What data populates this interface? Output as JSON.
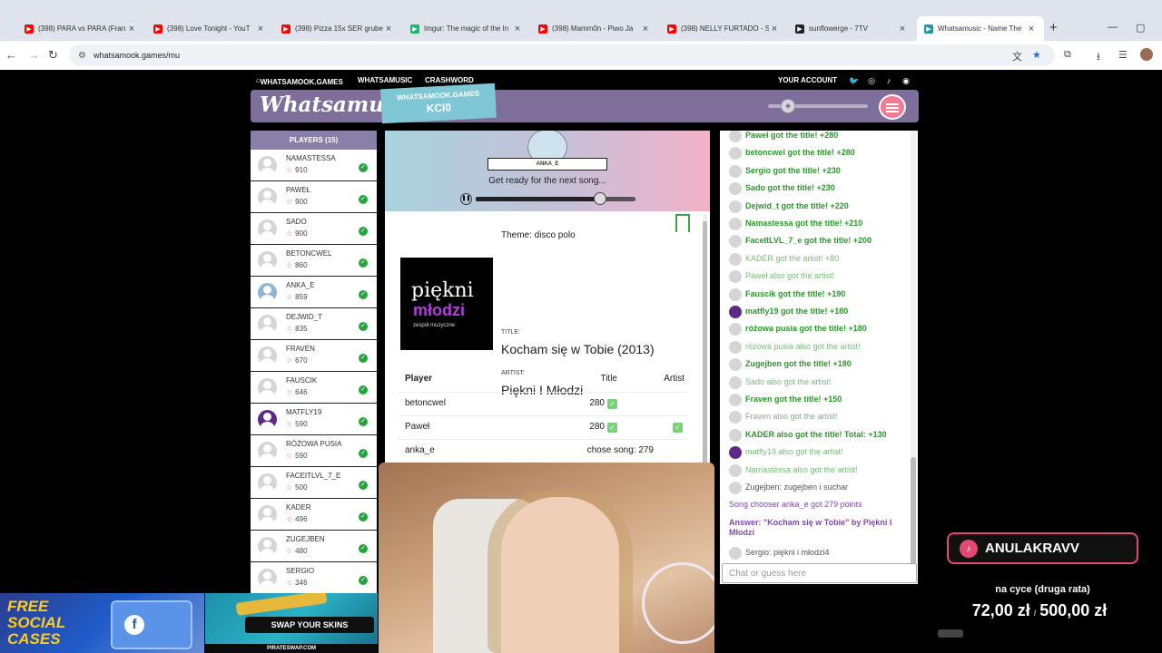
{
  "browser": {
    "tabs": [
      {
        "title": "(398) PARA vs PARA (Fran",
        "favicon": "youtube-icon",
        "color": "#ff0000"
      },
      {
        "title": "(398) Love Tonight - YouT",
        "favicon": "youtube-icon",
        "color": "#ff0000"
      },
      {
        "title": "(398) Pizza 15x SER grube",
        "favicon": "youtube-icon",
        "color": "#ff0000"
      },
      {
        "title": "Imgur: The magic of the In",
        "favicon": "imgur-icon",
        "color": "#1bb76e"
      },
      {
        "title": "(398) Mamm0n - Piwo Ja",
        "favicon": "youtube-icon",
        "color": "#ff0000"
      },
      {
        "title": "(398) NELLY FURTADO - S",
        "favicon": "youtube-icon",
        "color": "#ff0000"
      },
      {
        "title": "sunflowerge - 7TV",
        "favicon": "7tv-icon",
        "color": "#222222"
      },
      {
        "title": "Whatsamusic - Name The",
        "favicon": "whatsamusic-icon",
        "color": "#1a9aa8"
      }
    ],
    "url": "whatsamook.games/mu"
  },
  "nav": {
    "home": "WHATSAMOOK.GAMES",
    "whatsamusic": "WHATSAMUSIC",
    "crashword": "CRASHWORD",
    "account": "YOUR ACCOUNT"
  },
  "header": {
    "logo": "Whatsamusic",
    "room_site": "WHATSAMOOK.GAMES",
    "room_code": "KCI0",
    "volume": 0.15
  },
  "players": {
    "title": "PLAYERS (15)",
    "list": [
      {
        "name": "NAMASTESSA",
        "score": "910",
        "avatar": "default"
      },
      {
        "name": "PAWEŁ",
        "score": "900",
        "avatar": "default"
      },
      {
        "name": "SADO",
        "score": "900",
        "avatar": "default"
      },
      {
        "name": "BETONCWEL",
        "score": "860",
        "avatar": "default"
      },
      {
        "name": "ANKA_E",
        "score": "859",
        "avatar": "photo"
      },
      {
        "name": "DEJWID_T",
        "score": "835",
        "avatar": "default"
      },
      {
        "name": "FRAVEN",
        "score": "670",
        "avatar": "default"
      },
      {
        "name": "FAUSCIK",
        "score": "646",
        "avatar": "default"
      },
      {
        "name": "MATFLY19",
        "score": "590",
        "avatar": "purple"
      },
      {
        "name": "RÓŻOWA PUSIA",
        "score": "590",
        "avatar": "default"
      },
      {
        "name": "FACEITLVL_7_E",
        "score": "500",
        "avatar": "default"
      },
      {
        "name": "KADER",
        "score": "496",
        "avatar": "default"
      },
      {
        "name": "ZUGEJBEN",
        "score": "480",
        "avatar": "default"
      },
      {
        "name": "SERGIO",
        "score": "346",
        "avatar": "default"
      }
    ]
  },
  "round": {
    "chooser": "ANKA_E",
    "status": "Get ready for the next song...",
    "progress": 0.78,
    "theme": "Theme: disco polo",
    "cover_line1": "piękni",
    "cover_line2": "młodzi",
    "cover_line3": "zespół muzyczne",
    "title_label": "TITLE:",
    "title": "Kocham się w Tobie (2013)",
    "artist_label": "ARTIST:",
    "artist": "Piękni I Młodzi"
  },
  "results": {
    "headers": {
      "player": "Player",
      "title": "Title",
      "artist": "Artist"
    },
    "rows": [
      {
        "player": "betoncwel",
        "title": "280",
        "title_ok": true,
        "artist_ok": false,
        "note": ""
      },
      {
        "player": "Paweł",
        "title": "280",
        "title_ok": true,
        "artist_ok": true,
        "note": ""
      },
      {
        "player": "anka_e",
        "title": "",
        "title_ok": false,
        "artist_ok": false,
        "note": "chose song: 279"
      }
    ]
  },
  "chat": {
    "messages": [
      {
        "type": "g",
        "avatar": "default",
        "text": "Paweł got the title! +280"
      },
      {
        "type": "g",
        "avatar": "default",
        "text": "betoncwel got the title! +280"
      },
      {
        "type": "g",
        "avatar": "default",
        "text": "Sergio got the title! +230"
      },
      {
        "type": "g",
        "avatar": "default",
        "text": "Sado got the title! +230"
      },
      {
        "type": "g",
        "avatar": "default",
        "text": "Dejwid_t got the title! +220"
      },
      {
        "type": "g",
        "avatar": "default",
        "text": "Namastessa got the title! +210"
      },
      {
        "type": "g",
        "avatar": "default",
        "text": "FaceItLVL_7_e got the title! +200"
      },
      {
        "type": "l",
        "avatar": "default",
        "text": "KADER got the artist! +80"
      },
      {
        "type": "l",
        "avatar": "default",
        "text": "Paweł also got the artist!"
      },
      {
        "type": "g",
        "avatar": "default",
        "text": "Fauscik got the title! +190"
      },
      {
        "type": "g",
        "avatar": "purple",
        "text": "matfly19 got the title! +180"
      },
      {
        "type": "g",
        "avatar": "default",
        "text": "różowa pusia got the title! +180"
      },
      {
        "type": "l",
        "avatar": "default",
        "text": "różowa pusia also got the artist!"
      },
      {
        "type": "g",
        "avatar": "default",
        "text": "Zugejben got the title! +180"
      },
      {
        "type": "l",
        "avatar": "default",
        "text": "Sado also got the artist!"
      },
      {
        "type": "g",
        "avatar": "default",
        "text": "Fraven got the title! +150"
      },
      {
        "type": "l",
        "avatar": "default",
        "text": "Fraven also got the artist!"
      },
      {
        "type": "g",
        "avatar": "default",
        "text": "KADER also got the title! Total: +130"
      },
      {
        "type": "l",
        "avatar": "purple",
        "text": "matfly19 also got the artist!"
      },
      {
        "type": "l",
        "avatar": "default",
        "text": "Namastessa also got the artist!"
      },
      {
        "type": "n",
        "avatar": "default",
        "text": "Zugejben: zugejben i suchar"
      },
      {
        "type": "p",
        "avatar": "",
        "text": "Song chooser anka_e got 279 points"
      },
      {
        "type": "pb",
        "avatar": "",
        "text": "Answer: \"Kocham się w Tobie\" by Piękni I Młodzi"
      },
      {
        "type": "n",
        "avatar": "default",
        "text": "Sergio: piękni i młodzi4"
      }
    ],
    "input_placeholder": "Chat or guess here"
  },
  "overlay": {
    "tiktok_handle": "ANULAKRAVV",
    "goal_label": "na cyce (druga rata)",
    "goal_current": "72,00 zł",
    "goal_target": "500,00 zł",
    "ad1_line1": "FREE",
    "ad1_line2": "SOCIAL",
    "ad1_line3": "CASES",
    "ad2_button": "SWAP YOUR SKINS",
    "ad2_site": "PIRATESWAP.COM"
  }
}
